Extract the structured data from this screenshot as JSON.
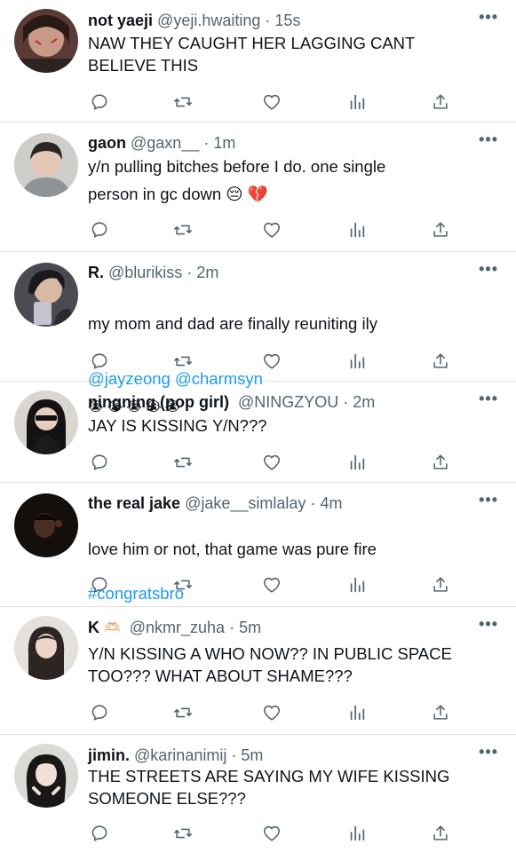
{
  "tweets": [
    {
      "name": "not yaeji",
      "handle": "@yeji.hwaiting",
      "sep": "·",
      "time": "15s",
      "text": "NAW THEY CAUGHT HER LAGGING CANT\nBELIEVE THIS",
      "avatar_color": "#5a3a34"
    },
    {
      "name": "gaon",
      "handle": "@gaxn__",
      "sep": "·",
      "time": "1m",
      "text": "y/n pulling bitches before I do. one single\nperson in gc down 😔 💔",
      "avatar_color": "#b8b6b3"
    },
    {
      "name": "R.",
      "handle": "@blurikiss",
      "sep": "·",
      "time": "2m",
      "text_main": "my mom and dad are finally reuniting ily",
      "text_mentions": "@jayzeong @charmsyn",
      "text_emojis": "😭 😭 😭 😭 😭",
      "avatar_color": "#3d3c44"
    },
    {
      "name": "ningning (pop girl)",
      "handle": "@NINGZYOU",
      "sep": "·",
      "time": "2m",
      "text": "JAY IS KISSING Y/N???",
      "avatar_color": "#2a2624"
    },
    {
      "name": "the real jake",
      "handle": "@jake__simlalay",
      "sep": "·",
      "time": "4m",
      "text_main": "love him or not, that game was pure fire",
      "text_hashtag": "#congratsbro",
      "avatar_color": "#1d1512"
    },
    {
      "name": "K",
      "name_emoji": "🫶🏻",
      "handle": "@nkmr_zuha",
      "sep": "·",
      "time": "5m",
      "text": "Y/N KISSING A WHO NOW?? IN PUBLIC SPACE\nTOO??? WHAT ABOUT SHAME???",
      "avatar_color": "#3a3331"
    },
    {
      "name": "jimin.",
      "handle": "@karinanimij",
      "sep": "·",
      "time": "5m",
      "text": "THE STREETS ARE SAYING MY WIFE KISSING\nSOMEONE ELSE???",
      "avatar_color": "#d9d6d2"
    }
  ],
  "more_label": "•••",
  "icons": [
    "reply-icon",
    "retweet-icon",
    "like-icon",
    "views-icon",
    "share-icon"
  ],
  "colors": {
    "link": "#1d9bf0",
    "secondary": "#536471",
    "divider": "#dfe3e6"
  }
}
